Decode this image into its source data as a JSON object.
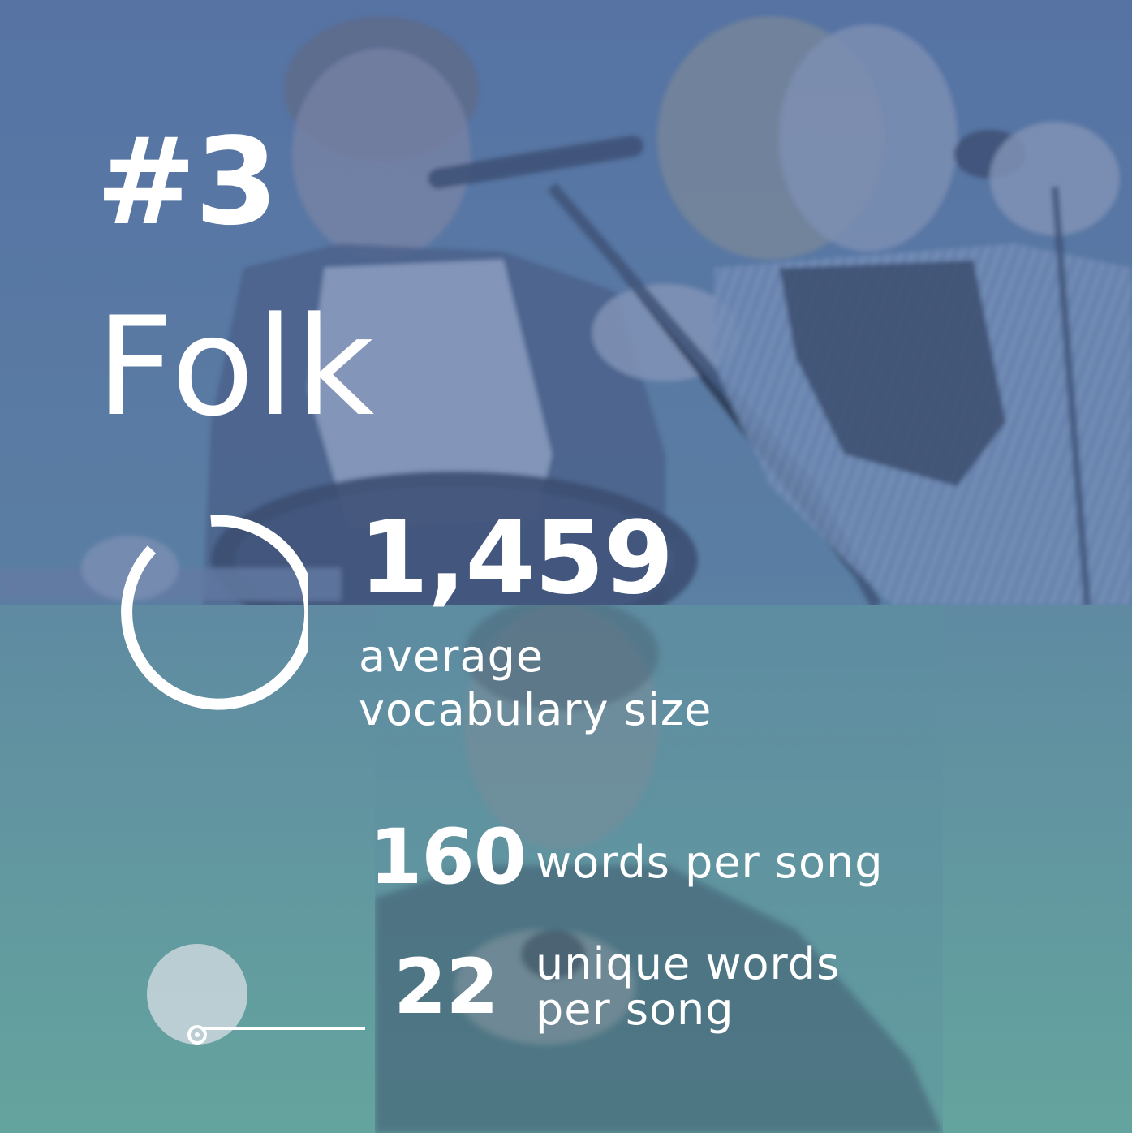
{
  "rank": "#3",
  "genre": "Folk",
  "vocabulary": {
    "value": "1,459",
    "label_line1": "average",
    "label_line2": "vocabulary size"
  },
  "words_per_song": {
    "value": "160",
    "label": "words per song"
  },
  "unique_words": {
    "value": "22",
    "label_line1": "unique words",
    "label_line2": "per song"
  },
  "colors": {
    "overlay_top": "#5673a4",
    "overlay_bottom": "#64a49e",
    "text": "#ffffff",
    "dot_fill": "#c9d6dc"
  },
  "icons": {
    "vocab_ring": "ring-gauge-icon",
    "unique_dot": "dot-connector-icon"
  }
}
